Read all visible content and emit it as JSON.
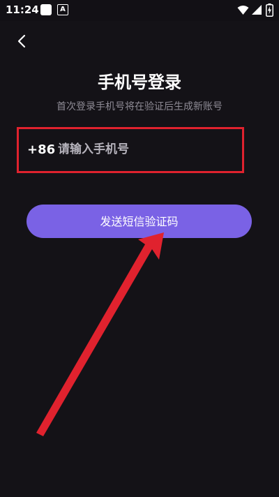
{
  "status_bar": {
    "time": "11:24",
    "notification_letter": "A",
    "icons": [
      "square-notification-icon",
      "a-notification-icon",
      "wifi-icon",
      "signal-icon",
      "battery-charging-icon"
    ]
  },
  "header": {
    "back_icon": "chevron-left-icon"
  },
  "login": {
    "title": "手机号登录",
    "subtitle": "首次登录手机号将在验证后生成新账号",
    "country_code": "+86",
    "phone_placeholder": "请输入手机号",
    "phone_value": "",
    "send_code_label": "发送短信验证码"
  },
  "annotation": {
    "highlight_color": "#e0222e",
    "arrow_color": "#e0222e"
  },
  "colors": {
    "background": "#141217",
    "accent": "#7a62e5",
    "subtitle_text": "#8e8b95"
  }
}
